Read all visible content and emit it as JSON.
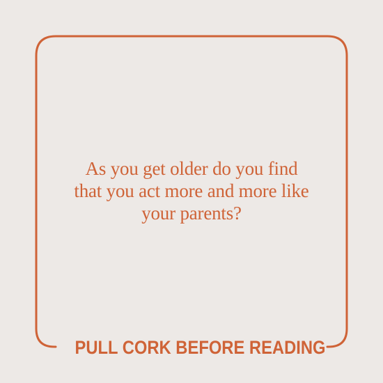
{
  "card": {
    "question_lines": [
      "As you get older do you find",
      "that you act more and more like",
      "your parents?"
    ],
    "footer_label": "PULL CORK BEFORE READING"
  },
  "colors": {
    "background": "#ede9e6",
    "accent": "#cf6337"
  }
}
